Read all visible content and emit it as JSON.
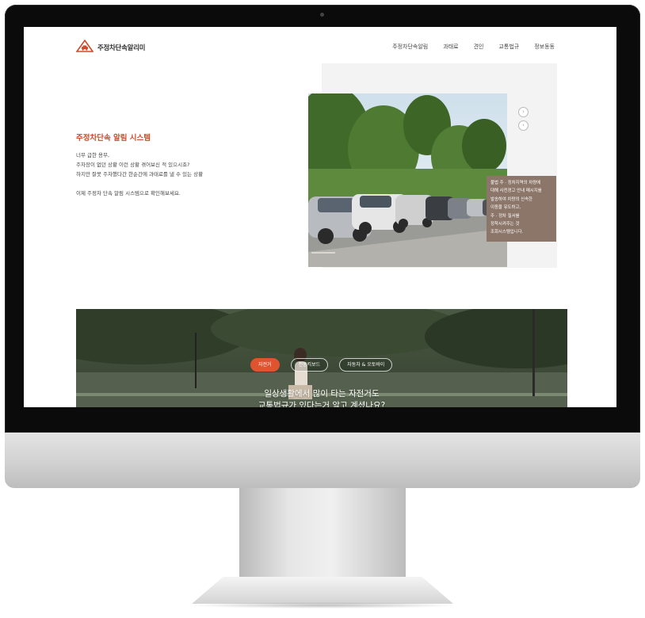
{
  "site": {
    "logo_text": "주정차단속알리미"
  },
  "nav": {
    "items": [
      "주정차단속알림",
      "과태료",
      "견인",
      "교통법규",
      "정보동동"
    ]
  },
  "hero": {
    "title": "주정차단속 알림 시스템",
    "lines": [
      "너무 급한 용무,",
      "주차장이 없던 상황 이런 상황 겪어보신 적 있으시죠?",
      "하지만 잘못 주차했다간 한순간에 과태료를 낼 수 있는 상황",
      "",
      "이제 주정차 단속 알림 시스템으로 확인해보세요."
    ]
  },
  "slider": {
    "caption_lines": [
      "불법 주 · 정차지역의 차량에",
      "대해 사전경고 안내 메시지를",
      "발송하여 차량의 신속한",
      "이동을 유도하고,",
      "주 · 정차 질서를",
      "정착시켜주는 것",
      "조회시스템입니다."
    ],
    "next_glyph": "›",
    "prev_glyph": "‹"
  },
  "banner": {
    "tabs": [
      "자전거",
      "전동킥보드",
      "자동차 & 오토바이"
    ],
    "active_tab": 0,
    "text_lines": [
      "일상생활에서 많이 타는 자전거도",
      "교통법규가 있다는거 알고 계셨나요?"
    ]
  },
  "colors": {
    "accent": "#d04a2c",
    "tab_active": "#e0532f",
    "caption_bg": "#8c7669",
    "bezel": "#0b0b0b"
  },
  "icons": {
    "logo": "warning-triangle-car-icon",
    "slider_next": "chevron-right-circle-icon",
    "slider_prev": "chevron-left-circle-icon"
  }
}
